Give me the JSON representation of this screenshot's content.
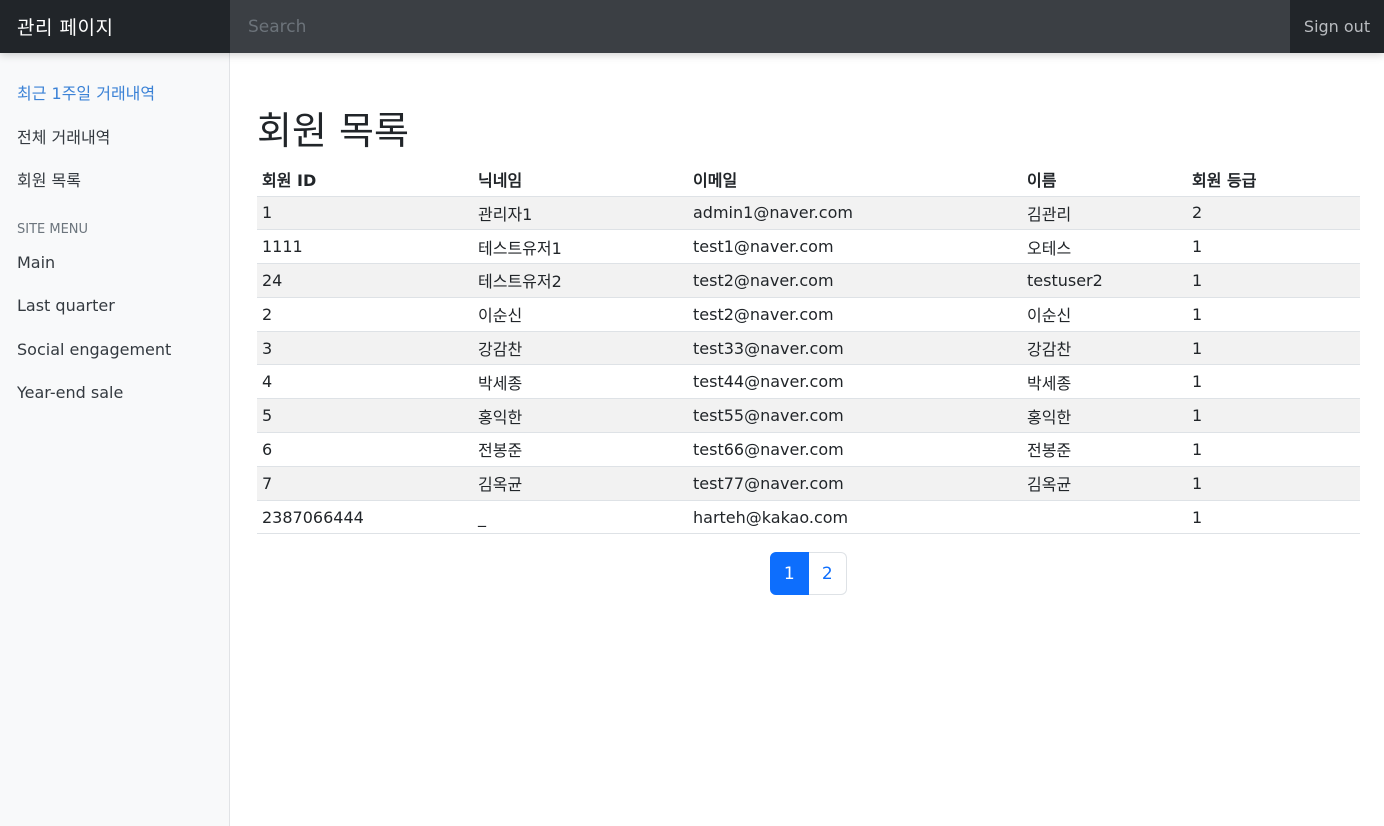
{
  "header": {
    "brand": "관리 페이지",
    "search_placeholder": "Search",
    "signout_label": "Sign out"
  },
  "sidebar": {
    "items": [
      {
        "label": "최근 1주일 거래내역"
      },
      {
        "label": "전체 거래내역"
      },
      {
        "label": "회원 목록"
      }
    ],
    "site_menu_heading": "SITE MENU",
    "site_menu": [
      {
        "label": "Main"
      },
      {
        "label": "Last quarter"
      },
      {
        "label": "Social engagement"
      },
      {
        "label": "Year-end sale"
      }
    ]
  },
  "main": {
    "title": "회원 목록",
    "columns": [
      "회원 ID",
      "닉네임",
      "이메일",
      "이름",
      "회원 등급"
    ],
    "rows": [
      [
        "1",
        "관리자1",
        "admin1@naver.com",
        "김관리",
        "2"
      ],
      [
        "1111",
        "테스트유저1",
        "test1@naver.com",
        "오테스",
        "1"
      ],
      [
        "24",
        "테스트유저2",
        "test2@naver.com",
        "testuser2",
        "1"
      ],
      [
        "2",
        "이순신",
        "test2@naver.com",
        "이순신",
        "1"
      ],
      [
        "3",
        "강감찬",
        "test33@naver.com",
        "강감찬",
        "1"
      ],
      [
        "4",
        "박세종",
        "test44@naver.com",
        "박세종",
        "1"
      ],
      [
        "5",
        "홍익한",
        "test55@naver.com",
        "홍익한",
        "1"
      ],
      [
        "6",
        "전봉준",
        "test66@naver.com",
        "전봉준",
        "1"
      ],
      [
        "7",
        "김옥균",
        "test77@naver.com",
        "김옥균",
        "1"
      ],
      [
        "2387066444",
        "_",
        "harteh@kakao.com",
        "",
        "1"
      ]
    ],
    "pagination": {
      "pages": [
        "1",
        "2"
      ],
      "current": "1"
    }
  },
  "colors": {
    "navbar": "#343a40",
    "brand_bg": "#212529",
    "active_link": "#3b82d6",
    "page_active": "#0d6efd"
  }
}
